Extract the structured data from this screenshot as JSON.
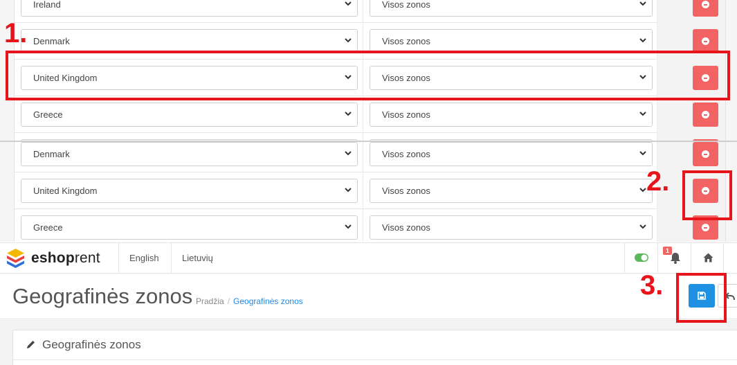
{
  "zone_label": "Visos zonos",
  "panel1": {
    "rows": [
      {
        "country": "Ireland",
        "zone": "Visos zonos"
      },
      {
        "country": "Denmark",
        "zone": "Visos zonos"
      },
      {
        "country": "United Kingdom",
        "zone": "Visos zonos"
      },
      {
        "country": "Greece",
        "zone": "Visos zonos"
      }
    ]
  },
  "panel2": {
    "rows": [
      {
        "country": "Denmark",
        "zone": "Visos zonos"
      },
      {
        "country": "United Kingdom",
        "zone": "Visos zonos"
      },
      {
        "country": "Greece",
        "zone": "Visos zonos"
      }
    ]
  },
  "annotations": [
    "1.",
    "2.",
    "3."
  ],
  "colors": {
    "annotation": "#e8141c",
    "delete": "#f26464",
    "save": "#1e91e3",
    "link": "#1e88e5"
  },
  "topbar": {
    "logo_bold": "eshop",
    "logo_light": "rent",
    "languages": [
      "English",
      "Lietuvių"
    ],
    "notification_count": "1"
  },
  "page": {
    "title": "Geografinės zonos",
    "breadcrumb_home": "Pradžia",
    "breadcrumb_current": "Geografinės zonos"
  },
  "card": {
    "title": "Geografinės zonos"
  },
  "icons": [
    "chevron-down-icon",
    "minus-circle-icon",
    "toggle-icon",
    "bell-icon",
    "home-icon",
    "save-icon",
    "undo-icon",
    "pencil-icon"
  ]
}
